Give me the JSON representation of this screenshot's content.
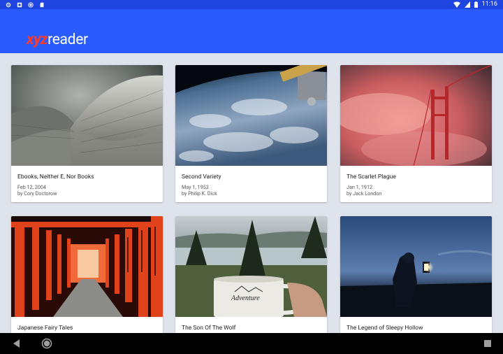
{
  "status_bar": {
    "time": "11:16",
    "left_icons": [
      "settings-icon",
      "android-icon",
      "record-icon",
      "sd-card-icon"
    ],
    "right_icons": [
      "wifi-icon",
      "signal-icon",
      "battery-icon"
    ]
  },
  "app_bar": {
    "logo_accent": "xyz",
    "logo_rest": "reader",
    "color": "#2a5bff"
  },
  "articles": [
    {
      "title": "Ebooks, Neither E, Nor Books",
      "date": "Feb 12, 2004",
      "author": "by Cory Doctorow",
      "image": "curved-roof-photo"
    },
    {
      "title": "Second Variety",
      "date": "May 1, 1953",
      "author": "by Philip K. Dick",
      "image": "earth-from-space-photo"
    },
    {
      "title": "The Scarlet Plague",
      "date": "Jan 1, 1912",
      "author": "by Jack London",
      "image": "golden-gate-fog-photo"
    },
    {
      "title": "Japanese Fairy Tales",
      "date": "",
      "author": "",
      "image": "torii-gates-photo"
    },
    {
      "title": "The Son Of The Wolf",
      "date": "",
      "author": "",
      "image": "mug-lake-photo"
    },
    {
      "title": "The Legend of Sleepy Hollow",
      "date": "",
      "author": "",
      "image": "lantern-night-photo"
    }
  ],
  "nav_bar": {
    "buttons": [
      "back-icon",
      "home-icon",
      "recents-icon"
    ]
  }
}
